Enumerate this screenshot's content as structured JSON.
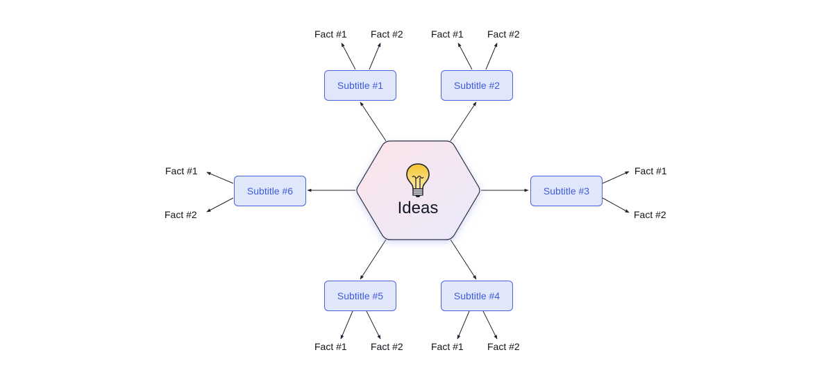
{
  "center": {
    "label": "Ideas",
    "icon": "lightbulb-icon"
  },
  "colors": {
    "box_fill": "#e1e7fb",
    "box_border": "#4a63dc",
    "box_text": "#3f5bd8",
    "hex_fill_start": "#fbe6ee",
    "hex_fill_end": "#ebe9f9",
    "line": "#1f2230",
    "bulb_fill": "#f5c93a"
  },
  "subtitles": [
    {
      "label": "Subtitle #1",
      "facts": [
        "Fact #1",
        "Fact #2"
      ]
    },
    {
      "label": "Subtitle #2",
      "facts": [
        "Fact #1",
        "Fact #2"
      ]
    },
    {
      "label": "Subtitle #3",
      "facts": [
        "Fact #1",
        "Fact #2"
      ]
    },
    {
      "label": "Subtitle #4",
      "facts": [
        "Fact #1",
        "Fact #2"
      ]
    },
    {
      "label": "Subtitle #5",
      "facts": [
        "Fact #1",
        "Fact #2"
      ]
    },
    {
      "label": "Subtitle #6",
      "facts": [
        "Fact #1",
        "Fact #2"
      ]
    }
  ]
}
